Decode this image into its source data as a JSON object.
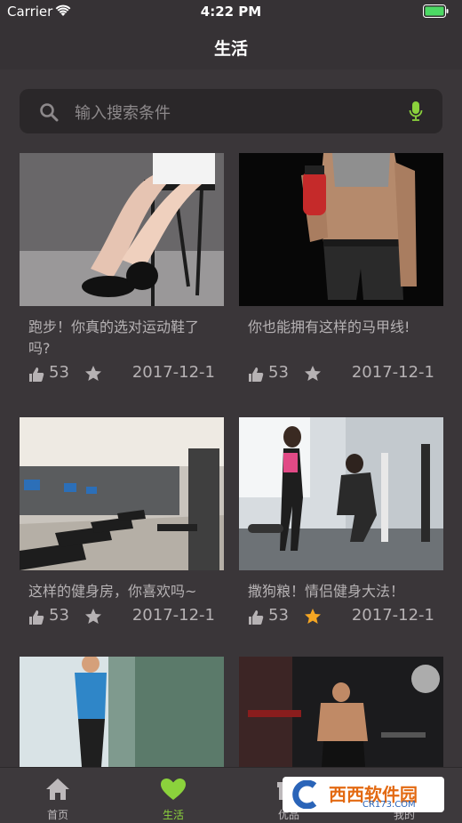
{
  "status_bar": {
    "carrier": "Carrier",
    "time": "4:22 PM"
  },
  "nav": {
    "title": "生活"
  },
  "search": {
    "placeholder": "输入搜索条件",
    "icon": "search-icon",
    "mic_icon": "microphone-icon"
  },
  "colors": {
    "accent": "#8bd23c",
    "star_active": "#f5a623",
    "background": "#3a3639"
  },
  "articles": [
    {
      "caption": "跑步！你真的选对运动鞋了吗?",
      "likes": "53",
      "date": "2017-12-1",
      "starred": false
    },
    {
      "caption": "你也能拥有这样的马甲线!",
      "likes": "53",
      "date": "2017-12-1",
      "starred": false
    },
    {
      "caption": "这样的健身房，你喜欢吗~",
      "likes": "53",
      "date": "2017-12-1",
      "starred": false
    },
    {
      "caption": "撒狗粮！情侣健身大法！",
      "likes": "53",
      "date": "2017-12-1",
      "starred": true
    },
    {
      "caption": "",
      "likes": "",
      "date": "",
      "starred": false
    },
    {
      "caption": "",
      "likes": "",
      "date": "",
      "starred": false
    }
  ],
  "tabbar": {
    "tabs": [
      {
        "label": "首页",
        "icon": "home-icon",
        "active": false
      },
      {
        "label": "生活",
        "icon": "heart-icon",
        "active": true
      },
      {
        "label": "优品",
        "icon": "gift-icon",
        "active": false
      },
      {
        "label": "我的",
        "icon": "profile-icon",
        "active": false
      }
    ]
  },
  "watermark": {
    "text": "西西软件园",
    "sub": "CR173.COM"
  }
}
